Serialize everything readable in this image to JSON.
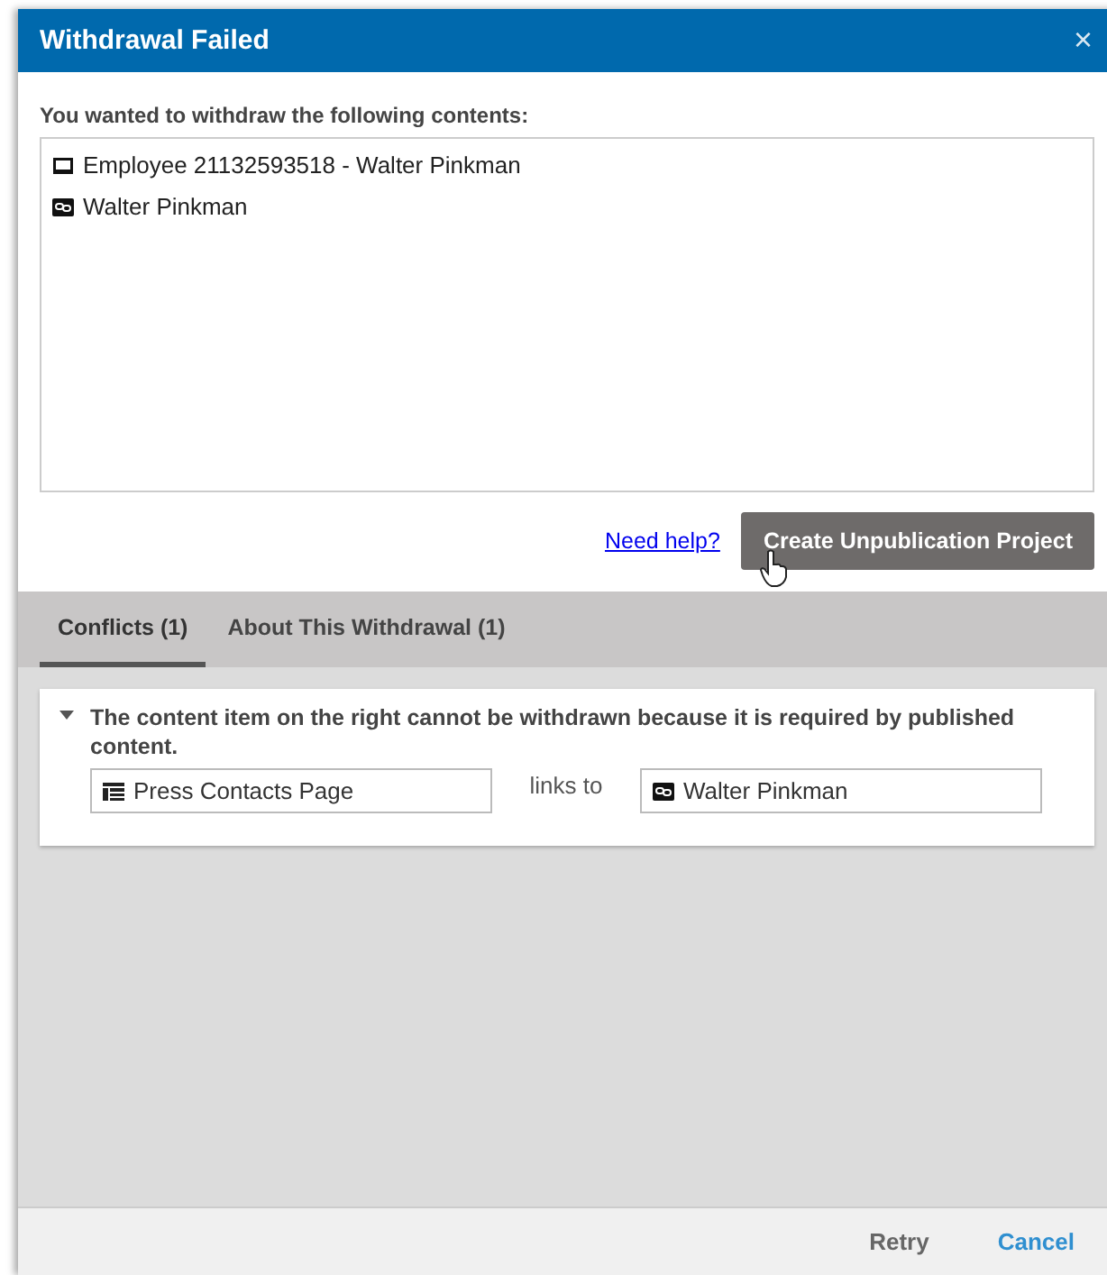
{
  "window": {
    "title": "Withdrawal Failed",
    "close": "×"
  },
  "intro": "You wanted to withdraw the following contents:",
  "contents": [
    {
      "kind": "article",
      "label": "Employee 21132593518 - Walter Pinkman"
    },
    {
      "kind": "link",
      "label": "Walter Pinkman"
    }
  ],
  "help_link": "Need help?",
  "primary_button": "Create Unpublication Project",
  "tabs": [
    {
      "label": "Conflicts (1)",
      "selected": true
    },
    {
      "label": "About This Withdrawal (1)",
      "selected": false
    }
  ],
  "conflicts": [
    {
      "expanded": true,
      "message": "The content item on the right cannot be withdrawn because it is required by published content.",
      "source": {
        "kind": "page",
        "label": "Press Contacts Page"
      },
      "relation": "links to",
      "target": {
        "kind": "link",
        "label": "Walter Pinkman"
      }
    }
  ],
  "footer_buttons": [
    {
      "label": "Retry",
      "kind": "secondary"
    },
    {
      "label": "Cancel",
      "kind": "primary"
    }
  ]
}
